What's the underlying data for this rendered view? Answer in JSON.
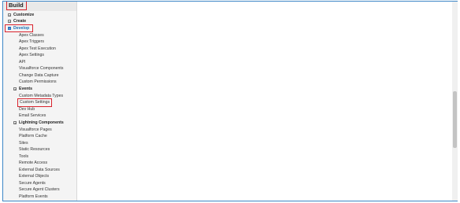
{
  "sidebar": {
    "section_title": "Build",
    "customize": "Customize",
    "create": "Create",
    "develop": "Develop",
    "develop_items": [
      "Apex Classes",
      "Apex Triggers",
      "Apex Test Execution",
      "Apex Settings",
      "API",
      "Visualforce Components",
      "Change Data Capture",
      "Custom Permissions"
    ],
    "events": "Events",
    "events_items": [
      "Custom Metadata Types",
      "Custom Settings",
      "Dev Hub",
      "Email Services"
    ],
    "lightning": "Lightning Components",
    "lightning_items": [
      "Visualforce Pages",
      "Platform Cache",
      "Sites",
      "Static Resources",
      "Tools",
      "Remote Access",
      "External Data Sources",
      "External Objects",
      "Secure Agents",
      "Secure Agent Clusters",
      "Platform Events"
    ],
    "toggle_plus": "+",
    "toggle_minus": "−"
  },
  "colors": {
    "highlight": "#d9232d",
    "active": "#1b6fb5",
    "frame_border": "#3d86c6"
  }
}
